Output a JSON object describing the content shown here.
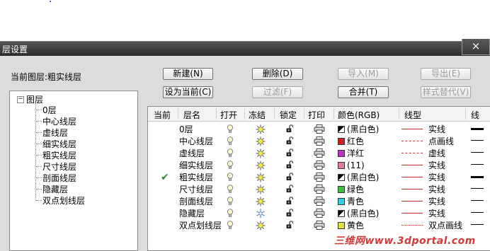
{
  "window": {
    "title": "层设置",
    "close_glyph": "×"
  },
  "current_layer_label": "当前图层:粗实线层",
  "buttons": {
    "new": "新建(N)",
    "delete": "删除(D)",
    "import": "导入(M)",
    "export": "导出(E)",
    "set_current": "设为当前(C)",
    "filter": "过滤(F)",
    "merge": "合并(T)",
    "style_replace": "样式替代(V)"
  },
  "tree": {
    "root": "图层",
    "root_toggle": "−",
    "children": [
      "0层",
      "中心线层",
      "虚线层",
      "细实线层",
      "粗实线层",
      "尺寸线层",
      "剖面线层",
      "隐藏层",
      "双点划线层"
    ]
  },
  "columns": [
    "当前",
    "层名",
    "打开",
    "冻结",
    "锁定",
    "打印",
    "颜色(RGB)",
    "线型",
    "线"
  ],
  "rows": [
    {
      "current": "",
      "name": "0层",
      "color_hex": "bw",
      "color_name": "(黑白色)",
      "linetype": "实线",
      "lt_style": "solid",
      "frozen": false,
      "lw": 3
    },
    {
      "current": "",
      "name": "中心线层",
      "color_hex": "#d42020",
      "color_name": "红色",
      "linetype": "点画线",
      "lt_style": "dashdot",
      "frozen": false,
      "lw": 1
    },
    {
      "current": "",
      "name": "虚线层",
      "color_hex": "#c030c0",
      "color_name": "洋红",
      "linetype": "虚线",
      "lt_style": "dashed",
      "frozen": false,
      "lw": 1
    },
    {
      "current": "",
      "name": "细实线层",
      "color_hex": "#e07aa0",
      "color_name": "(11)",
      "linetype": "实线",
      "lt_style": "solid",
      "frozen": false,
      "lw": 1
    },
    {
      "current": "✔",
      "name": "粗实线层",
      "color_hex": "bw",
      "color_name": "(黑白色)",
      "linetype": "实线",
      "lt_style": "solid",
      "frozen": false,
      "lw": 3
    },
    {
      "current": "",
      "name": "尺寸线层",
      "color_hex": "#40c040",
      "color_name": "绿色",
      "linetype": "实线",
      "lt_style": "solid",
      "frozen": false,
      "lw": 1
    },
    {
      "current": "",
      "name": "剖面线层",
      "color_hex": "#30d0e0",
      "color_name": "青色",
      "linetype": "实线",
      "lt_style": "solid",
      "frozen": false,
      "lw": 1
    },
    {
      "current": "",
      "name": "隐藏层",
      "color_hex": "bw",
      "color_name": "(黑白色)",
      "linetype": "实线",
      "lt_style": "solid",
      "frozen": true,
      "lw": 1
    },
    {
      "current": "",
      "name": "双点划线层",
      "color_hex": "#e0e040",
      "color_name": "黄色",
      "linetype": "双点画线",
      "lt_style": "dashdotdot",
      "frozen": false,
      "lw": 1
    }
  ],
  "icons": {
    "on": "lightbulb-icon",
    "freeze_off": "sun-icon",
    "freeze_on": "snowflake-icon",
    "lock": "padlock-open-icon",
    "print": "printer-icon"
  },
  "watermark": "三维网www.3dportal.com"
}
